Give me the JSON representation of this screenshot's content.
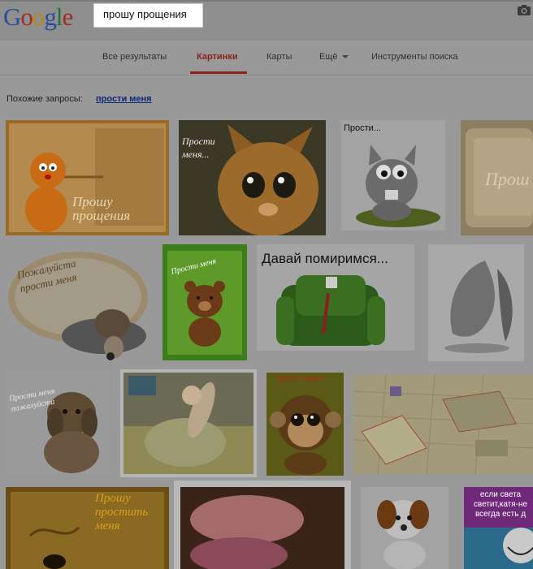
{
  "logo": {
    "letters": [
      "G",
      "o",
      "o",
      "g",
      "l",
      "e"
    ],
    "colors": [
      "#2d4b9e",
      "#a32a20",
      "#b38a17",
      "#2d4b9e",
      "#22753a",
      "#a32a20"
    ]
  },
  "search": {
    "query": "прошу прощения"
  },
  "tabs": [
    {
      "label": "Все результаты",
      "active": false
    },
    {
      "label": "Картинки",
      "active": true
    },
    {
      "label": "Карты",
      "active": false
    },
    {
      "label": "Ещё",
      "active": false
    },
    {
      "label": "Инструменты поиска",
      "active": false
    }
  ],
  "related": {
    "label": "Похожие запросы:",
    "link": "прости меня"
  },
  "images": {
    "row1": [
      {
        "caption": "Прошу прощения",
        "kind": "cat-gif"
      },
      {
        "caption": "Прости меня...",
        "kind": "puss-in-boots"
      },
      {
        "caption": "Прости...",
        "kind": "grey-cat"
      },
      {
        "caption": "Прош",
        "kind": "beige-card"
      }
    ],
    "row2": [
      {
        "caption": "Пожалуйста прости меня",
        "kind": "basset"
      },
      {
        "caption": "Прости меня",
        "kind": "bear"
      },
      {
        "caption": "Давай помиримся...",
        "kind": "armchair"
      },
      {
        "caption": "",
        "kind": "angel-sketch"
      }
    ],
    "row3": [
      {
        "caption": "Прости меня пожалуйста",
        "kind": "sad-dog"
      },
      {
        "caption": "",
        "kind": "baby-photo"
      },
      {
        "caption": "прости меня",
        "kind": "monkey"
      },
      {
        "caption": "",
        "kind": "city-map"
      }
    ],
    "row4": [
      {
        "caption": "Прошу простить меня",
        "kind": "gold-card"
      },
      {
        "caption": "",
        "kind": "closeup-photo"
      },
      {
        "caption": "",
        "kind": "puppy"
      },
      {
        "caption": "если света светит,катя-не всегда есть д",
        "kind": "meme"
      }
    ]
  },
  "colors": {
    "accent_tab": "#8a2218",
    "link": "#0b2a7a",
    "overlay": "#999999"
  }
}
